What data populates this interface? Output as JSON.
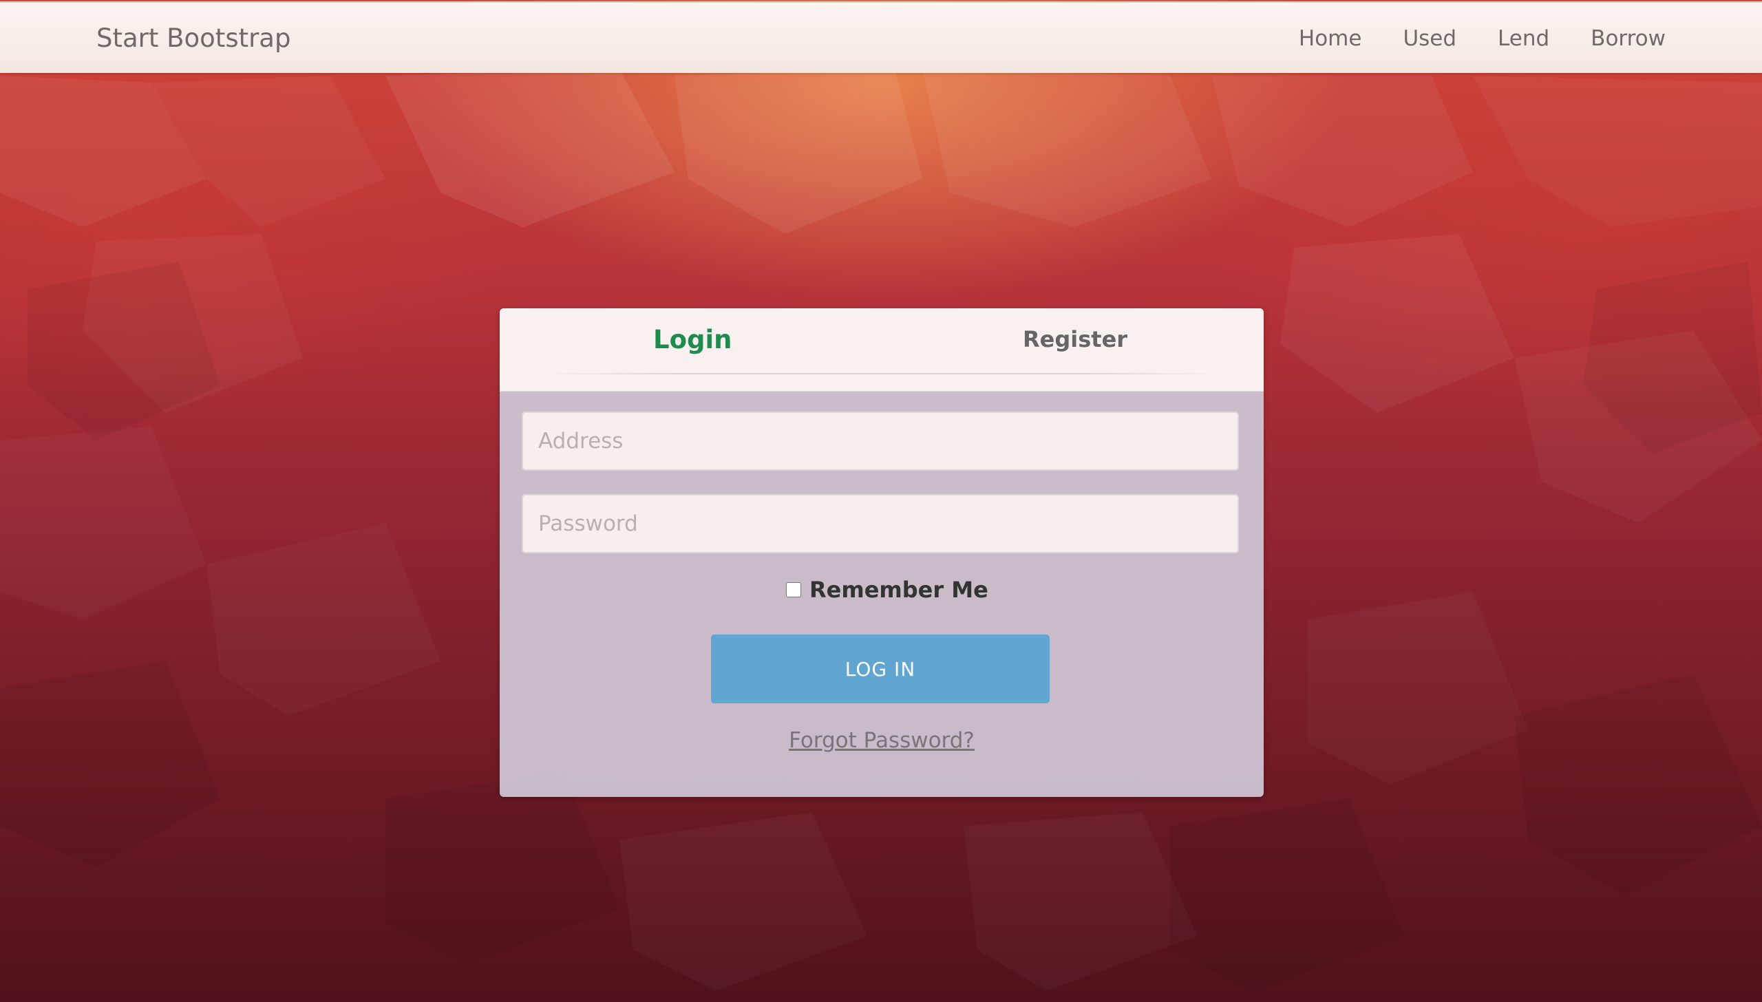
{
  "navbar": {
    "brand": "Start Bootstrap",
    "links": [
      {
        "label": "Home"
      },
      {
        "label": "Used"
      },
      {
        "label": "Lend"
      },
      {
        "label": "Borrow"
      }
    ]
  },
  "login_panel": {
    "tabs": {
      "login": "Login",
      "register": "Register"
    },
    "address_placeholder": "Address",
    "password_placeholder": "Password",
    "remember_label": "Remember Me",
    "login_button": "LOG IN",
    "forgot_link": "Forgot Password?"
  },
  "colors": {
    "active_tab": "#1f8c4f",
    "button": "#60a6d1",
    "background_top": "#d2473a",
    "background_bottom": "#4f111b"
  }
}
